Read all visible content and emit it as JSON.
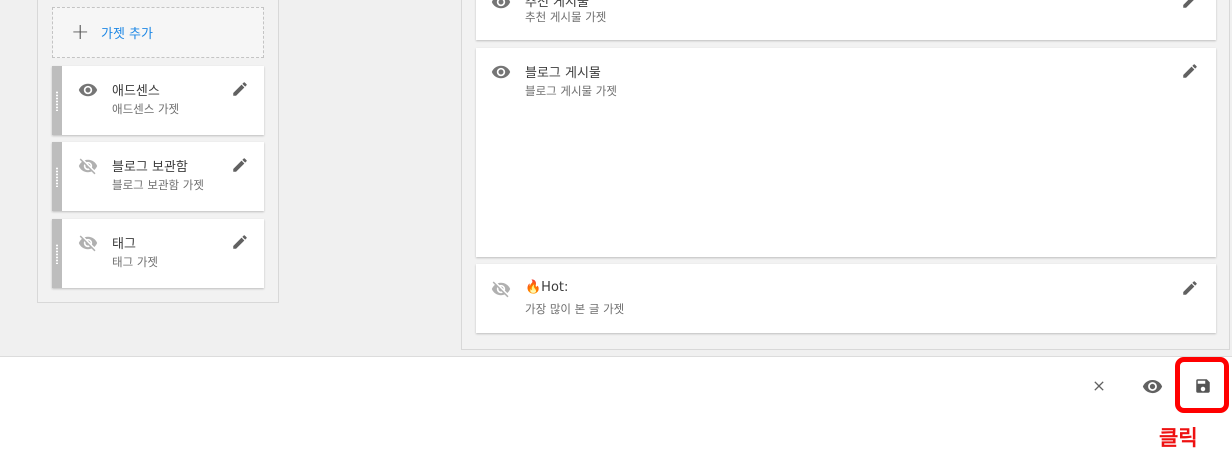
{
  "sidebar": {
    "add_gadget_label": "가젯 추가",
    "gadgets": [
      {
        "title": "애드센스",
        "subtitle": "애드센스 가젯",
        "visible": true
      },
      {
        "title": "블로그 보관함",
        "subtitle": "블로그 보관함 가젯",
        "visible": false
      },
      {
        "title": "태그",
        "subtitle": "태그 가젯",
        "visible": false
      }
    ]
  },
  "main": {
    "gadgets": [
      {
        "title": "추천 게시물",
        "subtitle": "추천 게시물 가젯",
        "visible": true
      },
      {
        "title": "블로그 게시물",
        "subtitle": "블로그 게시물 가젯",
        "visible": true
      },
      {
        "title": "🔥Hot:",
        "subtitle": "가장 많이 본 글 가젯",
        "visible": false
      }
    ]
  },
  "footer": {
    "close_icon": "close-icon",
    "preview_icon": "eye-icon",
    "save_icon": "save-icon"
  },
  "annotation": {
    "label": "클릭",
    "color": "#ff0000"
  },
  "colors": {
    "accent": "#1e88e5",
    "icon": "#757575",
    "icon_hidden": "#b0b0b0"
  }
}
